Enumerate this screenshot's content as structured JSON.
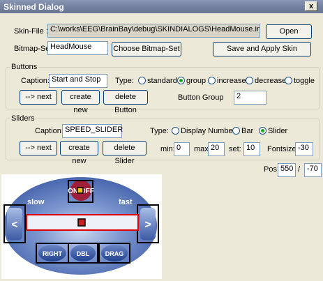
{
  "window": {
    "title": "Skinned Dialog",
    "close": "x"
  },
  "skin_file": {
    "label": "Skin-File :",
    "value": "C:\\works\\EEG\\BrainBay\\debug\\SKINDIALOGS\\HeadMouse.ini",
    "open_button": "Open"
  },
  "bitmap_set": {
    "label": "Bitmap-Set:",
    "value": "HeadMouse",
    "choose_button": "Choose Bitmap-Set",
    "save_button": "Save and Apply Skin"
  },
  "buttons_group": {
    "legend": "Buttons",
    "caption_label": "Caption:",
    "caption_value": "Start and Stop",
    "type_label": "Type:",
    "types": [
      {
        "label": "standard",
        "checked": false
      },
      {
        "label": "group",
        "checked": true
      },
      {
        "label": "increase",
        "checked": false
      },
      {
        "label": "decrease",
        "checked": false
      },
      {
        "label": "toggle",
        "checked": false
      }
    ],
    "next_button": "--> next",
    "create_button": "create new",
    "delete_button": "delete Button",
    "group_label": "Button Group",
    "group_value": "2"
  },
  "sliders_group": {
    "legend": "Sliders",
    "caption_label": "Caption:",
    "caption_value": "SPEED_SLIDER",
    "type_label": "Type:",
    "types": [
      {
        "label": "Display Number",
        "checked": false
      },
      {
        "label": "Bar",
        "checked": false
      },
      {
        "label": "Slider",
        "checked": true
      }
    ],
    "next_button": "--> next",
    "create_button": "create new",
    "delete_button": "delete Slider",
    "min_label": "min:",
    "min_value": "0",
    "max_label": "max:",
    "max_value": "20",
    "set_label": "set:",
    "set_value": "10",
    "fontsize_label": "Fontsize:",
    "fontsize_value": "-30"
  },
  "position": {
    "label": "Pos:",
    "x": "550",
    "separator": "/",
    "y": "-70"
  },
  "skin_preview": {
    "onoff": "ON/OFF",
    "slow": "slow",
    "fast": "fast",
    "left_arrow": "<",
    "right_arrow": ">",
    "right_btn": "RIGHT",
    "dbl_btn": "DBL",
    "drag_btn": "DRAG"
  },
  "colors": {
    "titlebar": "#74819f",
    "skin_ellipse": "#4f6fb3",
    "highlight_red": "#e00000",
    "onoff_button": "#a0203c"
  }
}
